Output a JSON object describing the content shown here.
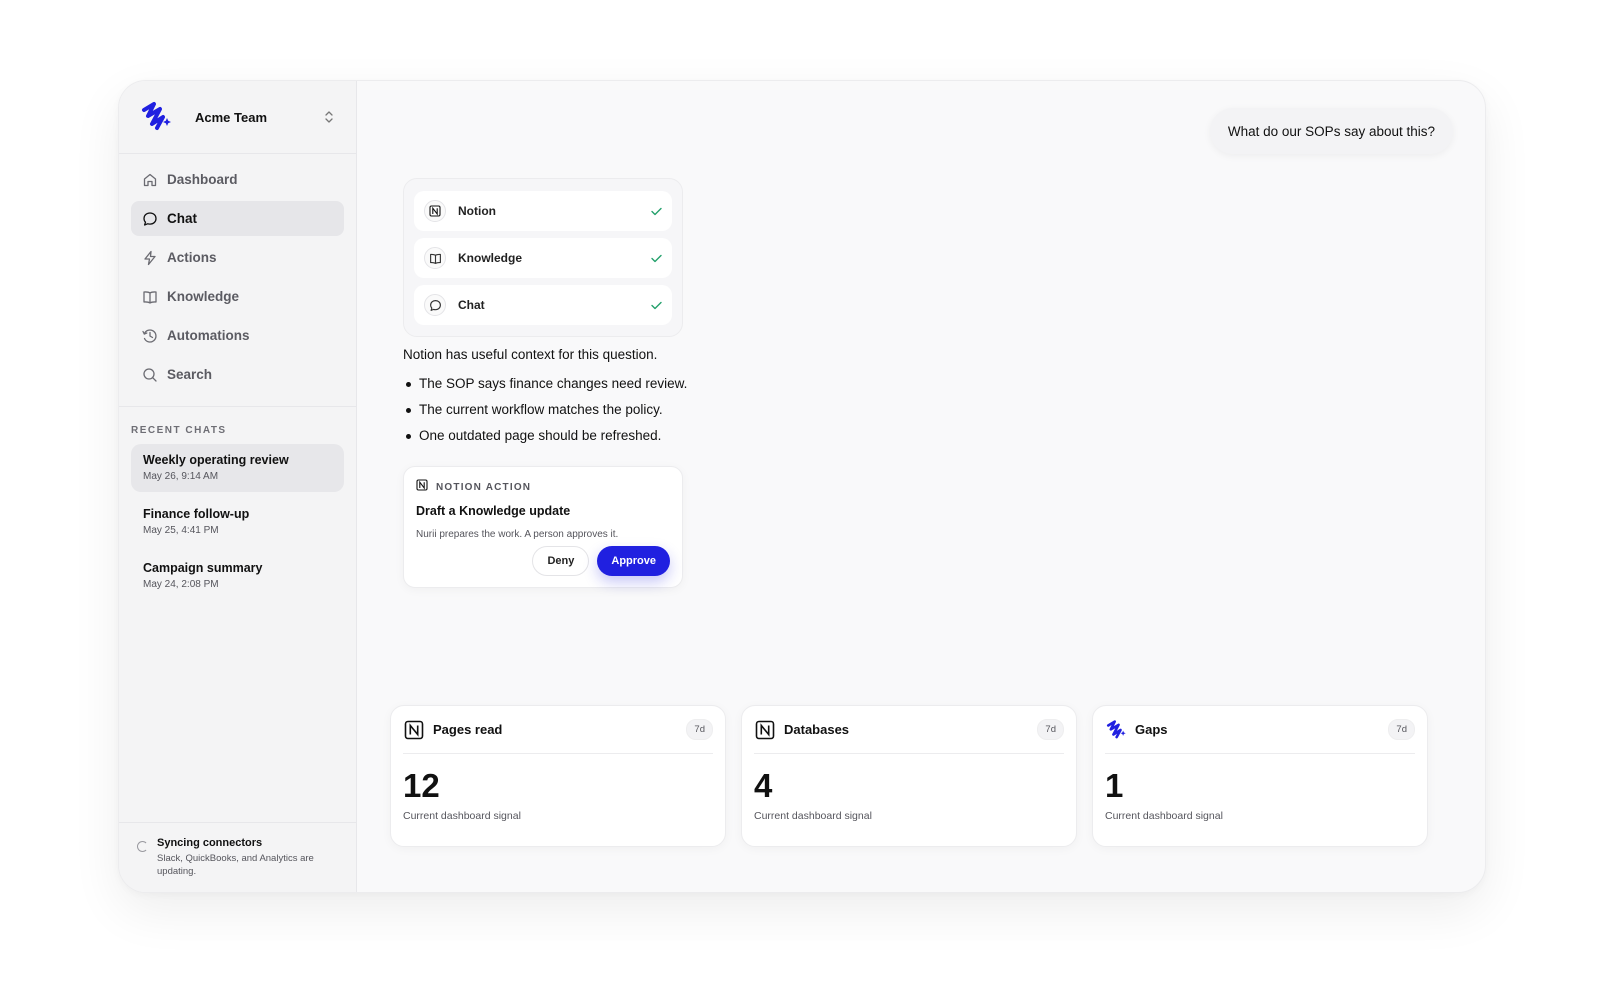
{
  "team": {
    "name": "Acme Team",
    "logo_icon": "nurii-logo",
    "switch_icon": "chevron-updown-icon"
  },
  "nav": [
    {
      "label": "Dashboard",
      "icon": "home-icon",
      "active": false
    },
    {
      "label": "Chat",
      "icon": "chat-bubble-icon",
      "active": true
    },
    {
      "label": "Actions",
      "icon": "lightning-icon",
      "active": false
    },
    {
      "label": "Knowledge",
      "icon": "book-icon",
      "active": false
    },
    {
      "label": "Automations",
      "icon": "clock-icon",
      "active": false
    },
    {
      "label": "Search",
      "icon": "search-icon",
      "active": false
    }
  ],
  "recent": {
    "label": "RECENT CHATS",
    "items": [
      {
        "title": "Weekly operating review",
        "date": "May 26, 9:14 AM",
        "active": true
      },
      {
        "title": "Finance follow-up",
        "date": "May 25, 4:41 PM",
        "active": false
      },
      {
        "title": "Campaign summary",
        "date": "May 24, 2:08 PM",
        "active": false
      }
    ]
  },
  "sync": {
    "title": "Syncing connectors",
    "subtitle": "Slack, QuickBooks, and Analytics are updating."
  },
  "chat": {
    "user_message": "What do our SOPs say about this?",
    "sources": [
      {
        "label": "Notion",
        "icon": "notion-icon",
        "status": "done"
      },
      {
        "label": "Knowledge",
        "icon": "book-icon",
        "status": "done"
      },
      {
        "label": "Chat",
        "icon": "chat-bubble-icon",
        "status": "done"
      }
    ],
    "answer": {
      "intro": "Notion has useful context for this question.",
      "bullets": [
        "The SOP says finance changes need review.",
        "The current workflow matches the policy.",
        "One outdated page should be refreshed."
      ]
    },
    "action": {
      "kicker": "NOTION ACTION",
      "title": "Draft a Knowledge update",
      "description": "Nurii prepares the work. A person approves it.",
      "deny_label": "Deny",
      "approve_label": "Approve"
    }
  },
  "stats": [
    {
      "label": "Pages read",
      "icon": "notion-icon",
      "badge": "7d",
      "value": "12",
      "sub": "Current dashboard signal"
    },
    {
      "label": "Databases",
      "icon": "notion-icon",
      "badge": "7d",
      "value": "4",
      "sub": "Current dashboard signal"
    },
    {
      "label": "Gaps",
      "icon": "nurii-logo",
      "badge": "7d",
      "value": "1",
      "sub": "Current dashboard signal"
    }
  ],
  "colors": {
    "accent": "#2020e0",
    "check": "#22a06b",
    "sidebar_bg": "#f4f4f5",
    "active_bg": "#e6e6e9"
  }
}
